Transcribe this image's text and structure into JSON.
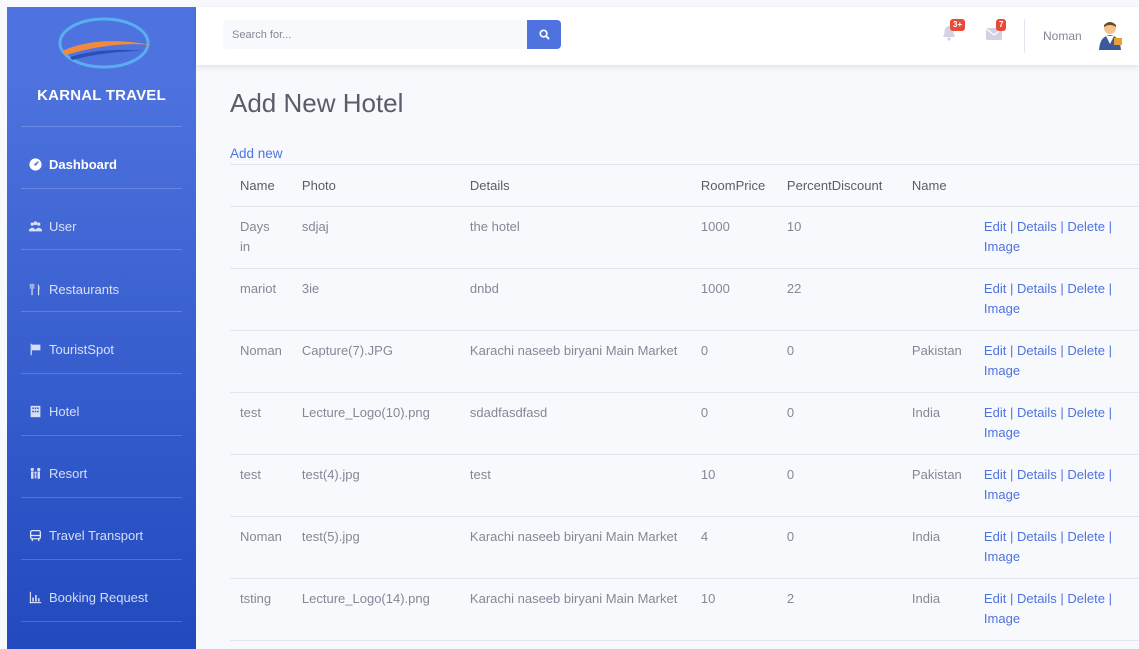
{
  "sidebar": {
    "brand": "KARNAL TRAVEL",
    "items": [
      {
        "label": "Dashboard",
        "icon": "tachometer-icon"
      },
      {
        "label": "User",
        "icon": "users-icon"
      },
      {
        "label": "Restaurants",
        "icon": "utensils-icon"
      },
      {
        "label": "TouristSpot",
        "icon": "flag-icon"
      },
      {
        "label": "Hotel",
        "icon": "building-icon"
      },
      {
        "label": "Resort",
        "icon": "family-icon"
      },
      {
        "label": "Travel Transport",
        "icon": "bus-icon"
      },
      {
        "label": "Booking Request",
        "icon": "chart-icon"
      }
    ]
  },
  "topbar": {
    "search_placeholder": "Search for...",
    "alerts_badge": "3+",
    "messages_badge": "7",
    "user_name": "Noman"
  },
  "main": {
    "title": "Add New Hotel",
    "add_new": "Add new"
  },
  "table": {
    "headers": [
      "Name",
      "Photo",
      "Details",
      "RoomPrice",
      "PercentDiscount",
      "Name",
      ""
    ],
    "rows": [
      {
        "name": "Days in",
        "photo": "sdjaj",
        "details": "the hotel",
        "price": "1000",
        "discount": "10",
        "country": ""
      },
      {
        "name": "mariot",
        "photo": "3ie",
        "details": "dnbd",
        "price": "1000",
        "discount": "22",
        "country": ""
      },
      {
        "name": "Noman",
        "photo": "Capture(7).JPG",
        "details": "Karachi naseeb biryani Main Market",
        "price": "0",
        "discount": "0",
        "country": "Pakistan"
      },
      {
        "name": "test",
        "photo": "Lecture_Logo(10).png",
        "details": "sdadfasdfasd",
        "price": "0",
        "discount": "0",
        "country": "India"
      },
      {
        "name": "test",
        "photo": "test(4).jpg",
        "details": "test",
        "price": "10",
        "discount": "0",
        "country": "Pakistan"
      },
      {
        "name": "Noman",
        "photo": "test(5).jpg",
        "details": "Karachi naseeb biryani Main Market",
        "price": "4",
        "discount": "0",
        "country": "India"
      },
      {
        "name": "tsting",
        "photo": "Lecture_Logo(14).png",
        "details": "Karachi naseeb biryani Main Market",
        "price": "10",
        "discount": "2",
        "country": "India"
      }
    ],
    "actions": {
      "edit": "Edit",
      "details": "Details",
      "delete": "Delete",
      "image": "Image",
      "separator": "|"
    }
  },
  "colors": {
    "primary": "#4e73df",
    "sidebar_dark": "#224abe",
    "badge": "#e74a3b",
    "logo_orange": "#f08a3c"
  }
}
